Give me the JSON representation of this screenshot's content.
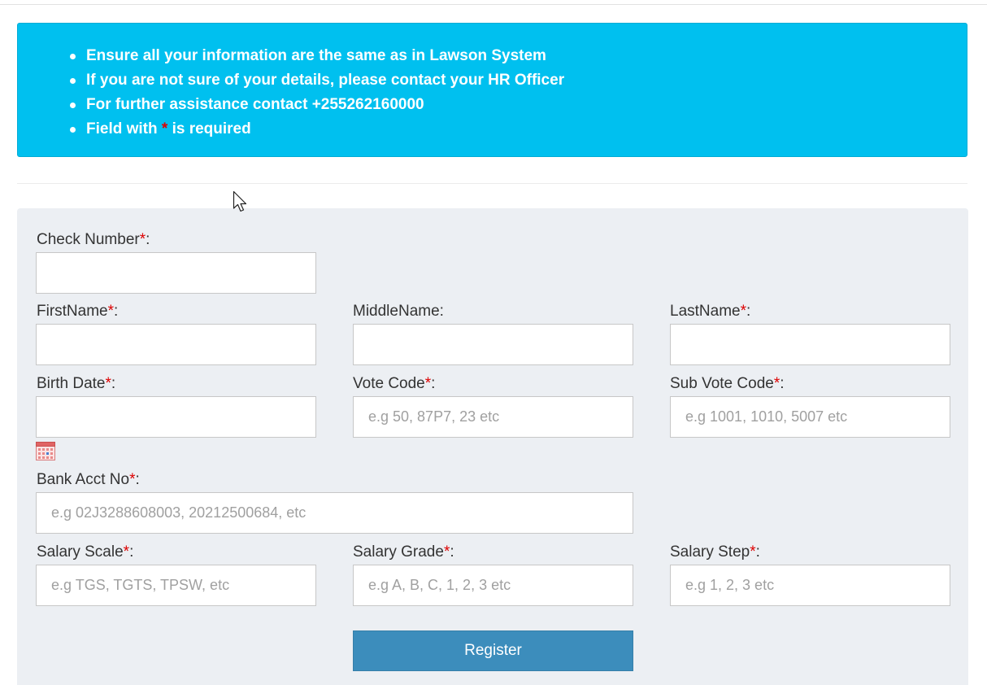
{
  "notice": {
    "items": [
      "Ensure all your information are the same as in Lawson System",
      "If you are not sure of your details, please contact your HR Officer",
      "For further assistance contact +255262160000"
    ],
    "required_prefix": "Field with ",
    "required_star": "*",
    "required_suffix": " is required"
  },
  "form": {
    "required_marker": "*",
    "check_number": {
      "label": "Check Number",
      "colon": ":",
      "value": "",
      "placeholder": ""
    },
    "first_name": {
      "label": "FirstName",
      "colon": ":",
      "value": "",
      "placeholder": ""
    },
    "middle_name": {
      "label": "MiddleName:",
      "value": "",
      "placeholder": ""
    },
    "last_name": {
      "label": "LastName",
      "colon": ":",
      "value": "",
      "placeholder": ""
    },
    "birth_date": {
      "label": "Birth Date",
      "colon": ":",
      "value": "",
      "placeholder": ""
    },
    "vote_code": {
      "label": "Vote Code",
      "colon": ":",
      "value": "",
      "placeholder": "e.g 50, 87P7, 23 etc"
    },
    "sub_vote_code": {
      "label": "Sub Vote Code",
      "colon": ":",
      "value": "",
      "placeholder": "e.g 1001, 1010, 5007 etc"
    },
    "bank_acct_no": {
      "label": "Bank Acct No",
      "colon": ":",
      "value": "",
      "placeholder": "e.g 02J3288608003, 20212500684, etc"
    },
    "salary_scale": {
      "label": "Salary Scale",
      "colon": ":",
      "value": "",
      "placeholder": "e.g TGS, TGTS, TPSW, etc"
    },
    "salary_grade": {
      "label": "Salary Grade",
      "colon": ":",
      "value": "",
      "placeholder": "e.g A, B, C, 1, 2, 3 etc"
    },
    "salary_step": {
      "label": "Salary Step",
      "colon": ":",
      "value": "",
      "placeholder": "e.g 1, 2, 3 etc"
    },
    "register_label": "Register"
  },
  "icons": {
    "calendar": "calendar-icon",
    "cursor": "mouse-pointer-icon"
  },
  "colors": {
    "notice_bg": "#00c0ef",
    "panel_bg": "#eceff3",
    "required": "#dd0000",
    "button_bg": "#3c8dbc"
  }
}
